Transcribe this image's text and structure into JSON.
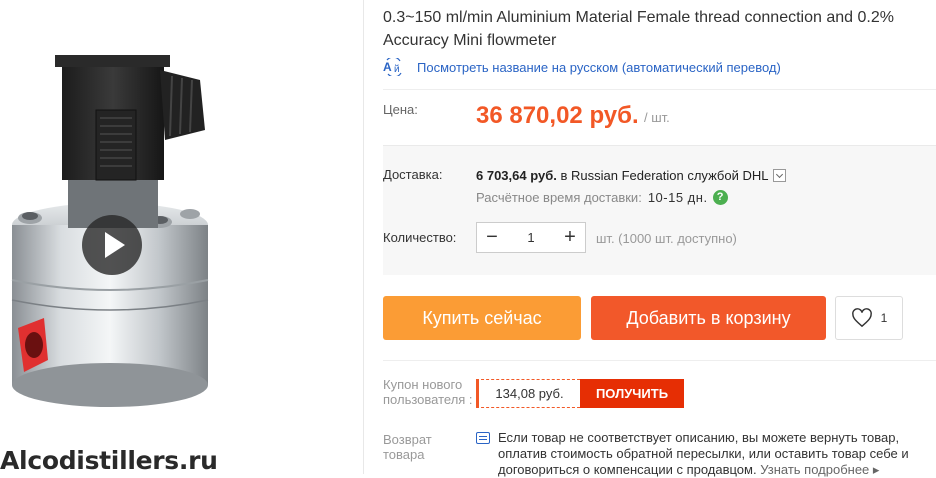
{
  "product": {
    "title": "0.3~150 ml/min Aluminium Material Female thread connection and 0.2% Accuracy Mini flowmeter",
    "translate_link": "Посмотреть название на русском (автоматический перевод)",
    "translate_icon": "translate-icon",
    "watermark": "Alcodistillers.ru",
    "play_icon": "play-icon"
  },
  "price": {
    "label": "Цена:",
    "value": "36 870,02 руб.",
    "unit": "/ шт.",
    "color": "#f25826"
  },
  "shipping": {
    "label": "Доставка:",
    "cost": "6 703,64 руб.",
    "destination": "в Russian Federation службой DHL",
    "eta_label": "Расчётное время доставки:",
    "eta_value": "10-15 дн."
  },
  "quantity": {
    "label": "Количество:",
    "value": "1",
    "minus": "−",
    "plus": "+",
    "available": "шт. (1000 шт. доступно)"
  },
  "actions": {
    "buy_now": "Купить сейчас",
    "add_to_cart": "Добавить в корзину",
    "wishlist_count": "1",
    "buy_color": "#fb9c35",
    "cart_color": "#f2582a"
  },
  "coupon": {
    "label": "Купон нового пользователя :",
    "amount": "134,08 руб.",
    "button": "ПОЛУЧИТЬ"
  },
  "returns": {
    "label": "Возврат товара",
    "text": "Если товар не соответствует описанию, вы можете вернуть товар, оплатив стоимость обратной пересылки, или оставить товар себе и договориться о компенсации с продавцом.",
    "more": "Узнать подробнее ▸"
  }
}
